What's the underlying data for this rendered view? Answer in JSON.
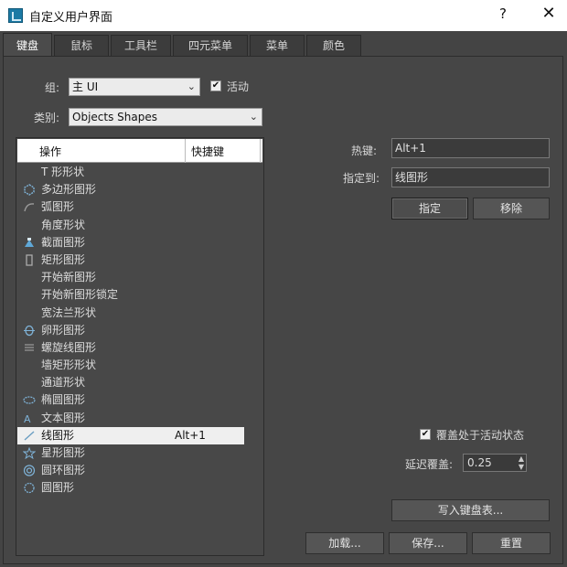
{
  "window": {
    "title": "自定义用户界面",
    "help": "?",
    "close": "✕"
  },
  "tabs": [
    {
      "label": "键盘",
      "active": true
    },
    {
      "label": "鼠标"
    },
    {
      "label": "工具栏"
    },
    {
      "label": "四元菜单"
    },
    {
      "label": "菜单"
    },
    {
      "label": "颜色"
    }
  ],
  "group": {
    "label": "组:",
    "value": "主 UI"
  },
  "active": {
    "label": "活动",
    "checked": true
  },
  "category": {
    "label": "类别:",
    "value": "Objects Shapes"
  },
  "list": {
    "col_action": "操作",
    "col_shortcut": "快捷键",
    "rows": [
      {
        "text": "T 形形状",
        "key": "",
        "icon": ""
      },
      {
        "text": "多边形图形",
        "key": "",
        "icon": "ngon-icon"
      },
      {
        "text": "弧图形",
        "key": "",
        "icon": "arc-icon"
      },
      {
        "text": "角度形状",
        "key": "",
        "icon": ""
      },
      {
        "text": "截面图形",
        "key": "",
        "icon": "section-icon"
      },
      {
        "text": "矩形图形",
        "key": "",
        "icon": "rectangle-icon"
      },
      {
        "text": "开始新图形",
        "key": "",
        "icon": ""
      },
      {
        "text": "开始新图形锁定",
        "key": "",
        "icon": ""
      },
      {
        "text": "宽法兰形状",
        "key": "",
        "icon": ""
      },
      {
        "text": "卵形图形",
        "key": "",
        "icon": "egg-icon"
      },
      {
        "text": "螺旋线图形",
        "key": "",
        "icon": "helix-icon"
      },
      {
        "text": "墙矩形形状",
        "key": "",
        "icon": ""
      },
      {
        "text": "通道形状",
        "key": "",
        "icon": ""
      },
      {
        "text": "椭圆图形",
        "key": "",
        "icon": "ellipse-icon"
      },
      {
        "text": "文本图形",
        "key": "",
        "icon": "text-icon"
      },
      {
        "text": "线图形",
        "key": "Alt+1",
        "icon": "line-icon",
        "selected": true
      },
      {
        "text": "星形图形",
        "key": "",
        "icon": "star-icon"
      },
      {
        "text": "圆环图形",
        "key": "",
        "icon": "donut-icon"
      },
      {
        "text": "圆图形",
        "key": "",
        "icon": "circle-icon"
      }
    ]
  },
  "hotkey": {
    "label": "热键:",
    "value": "Alt+1"
  },
  "assigned_to": {
    "label": "指定到:",
    "value": "线图形"
  },
  "buttons": {
    "assign": "指定",
    "remove": "移除",
    "write_keyboard": "写入键盘表...",
    "load": "加载...",
    "save": "保存...",
    "reset": "重置"
  },
  "override": {
    "label": "覆盖处于活动状态",
    "checked": true
  },
  "delay": {
    "label": "延迟覆盖:",
    "value": "0.25"
  }
}
